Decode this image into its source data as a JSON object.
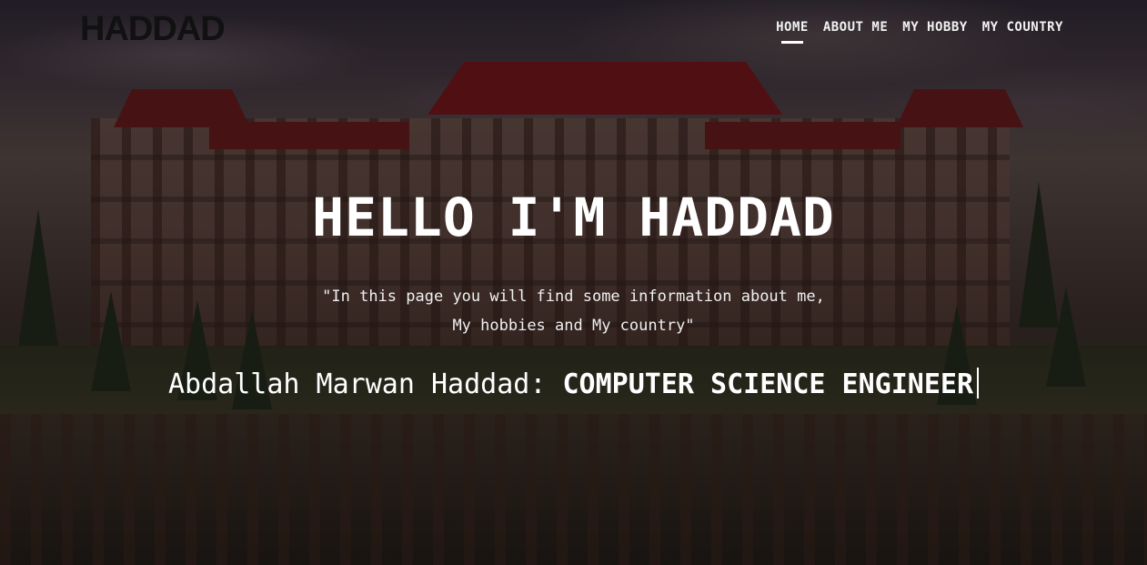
{
  "brand": {
    "logo_text": "HADDAD"
  },
  "nav": {
    "items": [
      {
        "label": "HOME",
        "active": true
      },
      {
        "label": "ABOUT ME",
        "active": false
      },
      {
        "label": "MY HOBBY",
        "active": false
      },
      {
        "label": "MY COUNTRY",
        "active": false
      }
    ]
  },
  "hero": {
    "title": "HELLO I'M HADDAD",
    "subtitle_line1": "\"In this page you will find some information about me,",
    "subtitle_line2": "My hobbies and My country\"",
    "name_prefix": "Abdallah Marwan Haddad:",
    "typed_role": "COMPUTER SCIENCE ENGINEER"
  }
}
